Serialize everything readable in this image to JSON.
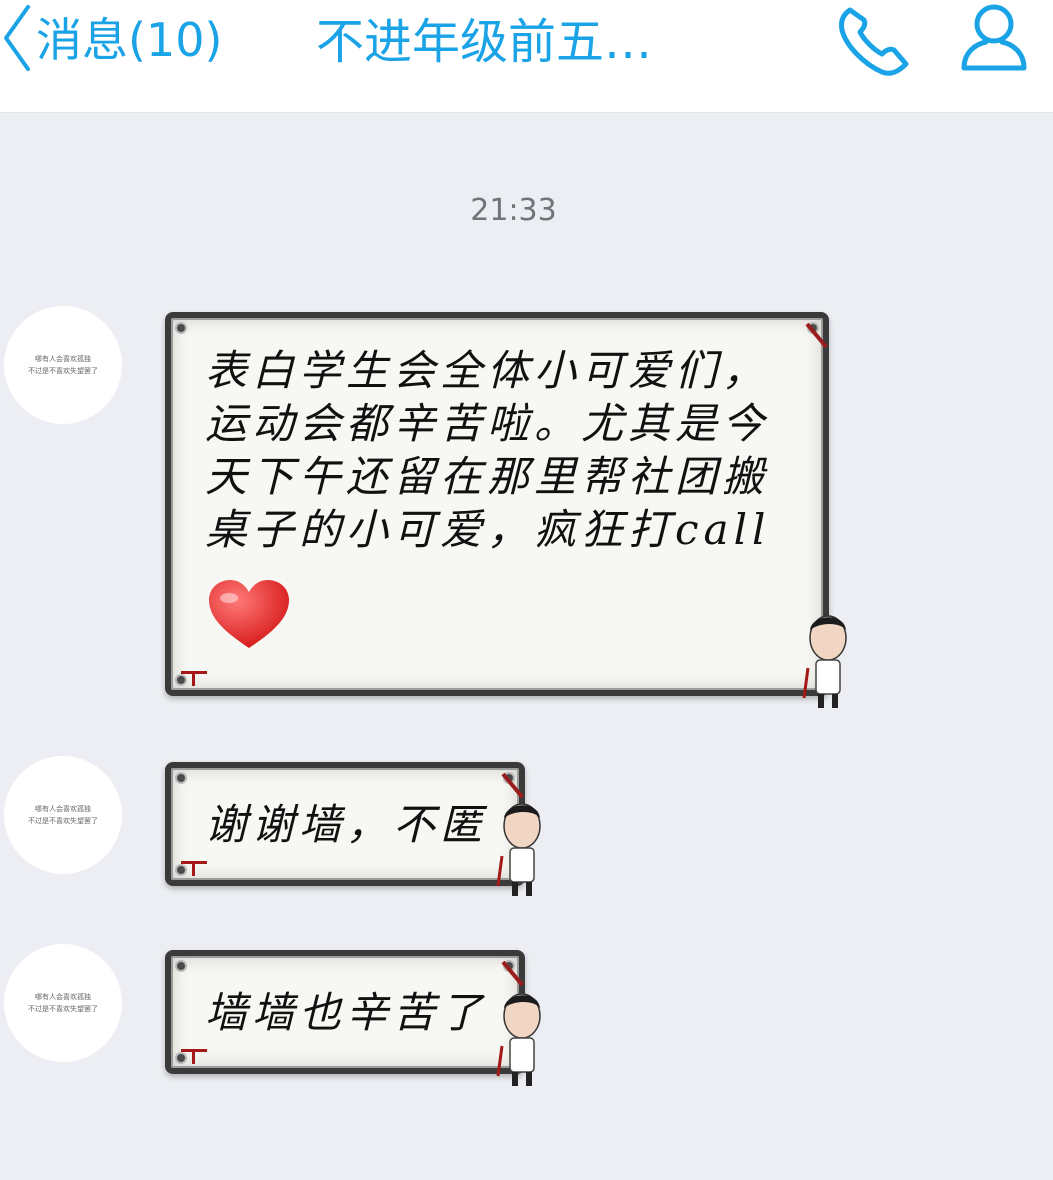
{
  "header": {
    "back_label": "消息(10)",
    "title": "不进年级前五…",
    "icons": [
      "chevron-left-icon",
      "phone-icon",
      "user-icon"
    ],
    "accent_color": "#1aa3e6"
  },
  "chat": {
    "timestamp": "21:33",
    "avatar_lines": [
      "哪有人会喜欢孤独",
      "不过是不喜欢失望罢了"
    ],
    "messages": [
      {
        "text": "表白学生会全体小可爱们，运动会都辛苦啦。尤其是今天下午还留在那里帮社团搬桌子的小可爱，疯狂打call",
        "emoji": "heart-icon"
      },
      {
        "text": "谢谢墙，不匿"
      },
      {
        "text": "墙墙也辛苦了"
      }
    ]
  }
}
